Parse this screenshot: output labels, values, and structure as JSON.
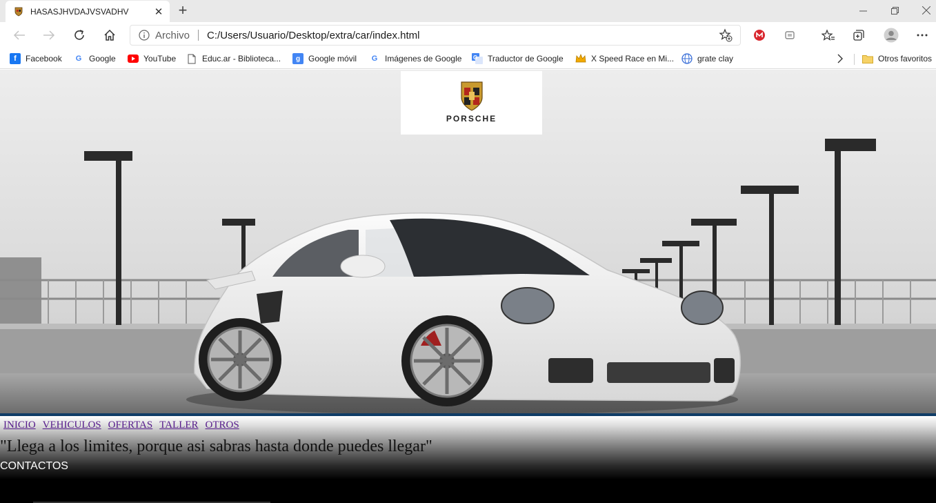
{
  "browser": {
    "tab_title": "HASASJHVDAJVSVADHV",
    "new_tab_label": "+",
    "omnibox": {
      "scheme_label": "Archivo",
      "url": "C:/Users/Usuario/Desktop/extra/car/index.html"
    },
    "bookmarks": [
      {
        "label": "Facebook",
        "icon": "facebook-icon",
        "color": "#1877f2"
      },
      {
        "label": "Google",
        "icon": "google-icon",
        "color": "#4285f4"
      },
      {
        "label": "YouTube",
        "icon": "youtube-icon",
        "color": "#ff0000"
      },
      {
        "label": "Educ.ar - Biblioteca...",
        "icon": "page-icon",
        "color": "#555555"
      },
      {
        "label": "Google móvil",
        "icon": "google-mobile-icon",
        "color": "#4285f4"
      },
      {
        "label": "Imágenes de Google",
        "icon": "google-icon",
        "color": "#4285f4"
      },
      {
        "label": "Traductor de Google",
        "icon": "translate-icon",
        "color": "#4285f4"
      },
      {
        "label": "X Speed Race en Mi...",
        "icon": "crown-icon",
        "color": "#f2a900"
      },
      {
        "label": "grate clay",
        "icon": "globe-icon",
        "color": "#3a6fd8"
      }
    ],
    "other_favorites_label": "Otros favoritos"
  },
  "page": {
    "logo_text": "PORSCHE",
    "menu": [
      "INICIO",
      "VEHICULOS",
      "OFERTAS",
      "TALLER",
      "OTROS"
    ],
    "slogan": "\"Llega a los limites, porque asi sabras hasta donde puedes llegar\"",
    "contacts_label": "CONTACTOS"
  },
  "colors": {
    "accent_bar": "#0f3c66",
    "visited_link": "#551a8b"
  }
}
